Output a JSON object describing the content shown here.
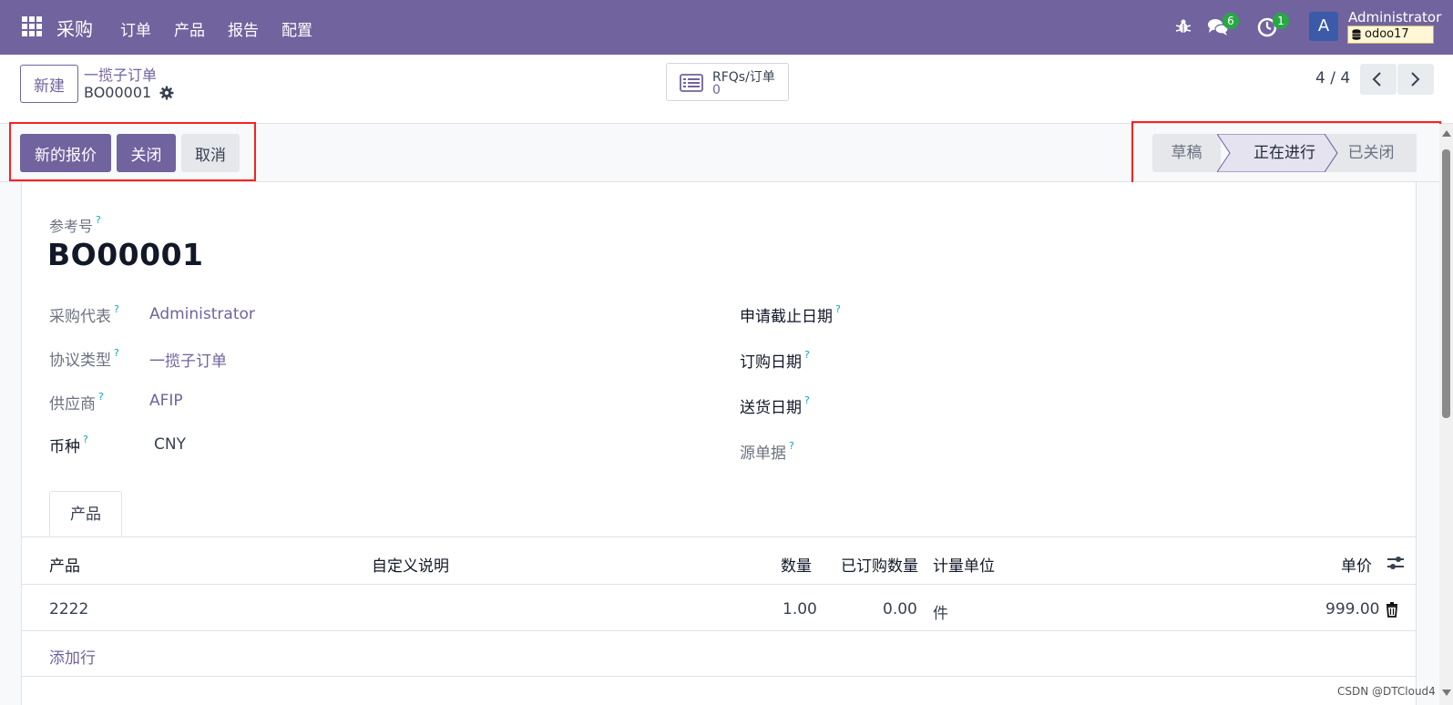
{
  "navbar": {
    "app_title": "采购",
    "menu": [
      "订单",
      "产品",
      "报告",
      "配置"
    ],
    "chat_count": "6",
    "activity_count": "1",
    "avatar_letter": "A",
    "user_name": "Administrator",
    "database": "odoo17"
  },
  "control_panel": {
    "new_label": "新建",
    "breadcrumb_parent": "一揽子订单",
    "breadcrumb_current": "BO00001",
    "smart_button": {
      "label": "RFQs/订单",
      "count": "0"
    },
    "pager": "4 / 4"
  },
  "statusbar": {
    "buttons": {
      "new_quote": "新的报价",
      "close": "关闭",
      "cancel": "取消"
    },
    "stages": {
      "draft": "草稿",
      "in_progress": "正在进行",
      "closed": "已关闭"
    },
    "active_stage": "正在进行"
  },
  "form": {
    "reference_label": "参考号",
    "reference_value": "BO00001",
    "help_mark": "?",
    "left_fields": [
      {
        "label": "采购代表",
        "value": "Administrator"
      },
      {
        "label": "协议类型",
        "value": "一揽子订单"
      },
      {
        "label": "供应商",
        "value": "AFIP"
      },
      {
        "label": "币种",
        "value": "CNY"
      }
    ],
    "right_fields": [
      {
        "label": "申请截止日期",
        "value": ""
      },
      {
        "label": "订购日期",
        "value": ""
      },
      {
        "label": "送货日期",
        "value": ""
      },
      {
        "label": "源单据",
        "value": ""
      }
    ]
  },
  "tabs": [
    "产品"
  ],
  "lines_table": {
    "columns": [
      "产品",
      "自定义说明",
      "数量",
      "已订购数量",
      "计量单位",
      "单价"
    ],
    "rows": [
      {
        "product": "2222",
        "description": "",
        "quantity": "1.00",
        "ordered_qty": "0.00",
        "uom": "件",
        "unit_price": "999.00"
      }
    ],
    "add_line": "添加行"
  },
  "watermark": "CSDN @DTCloud4",
  "colors": {
    "brand": "#71639e",
    "highlight_box": "#ff1f1f",
    "badge": "#28a745"
  }
}
